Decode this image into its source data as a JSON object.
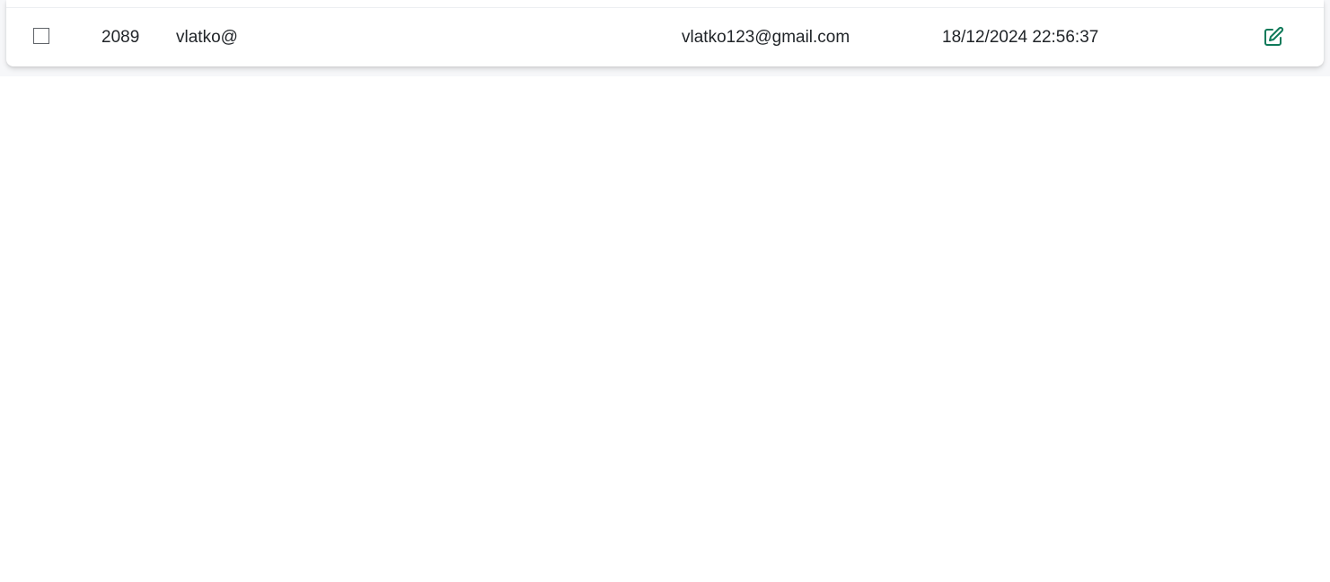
{
  "table": {
    "rows": [
      {
        "id": "2089",
        "username": "vlatko@",
        "email": "vlatko123@gmail.com",
        "created": "18/12/2024 22:56:37",
        "checked": false,
        "action_icon": "edit-icon"
      }
    ]
  },
  "colors": {
    "accent": "#0f7a5a",
    "text": "#212529",
    "row_shadow": "rgba(0,0,0,0.12)"
  }
}
